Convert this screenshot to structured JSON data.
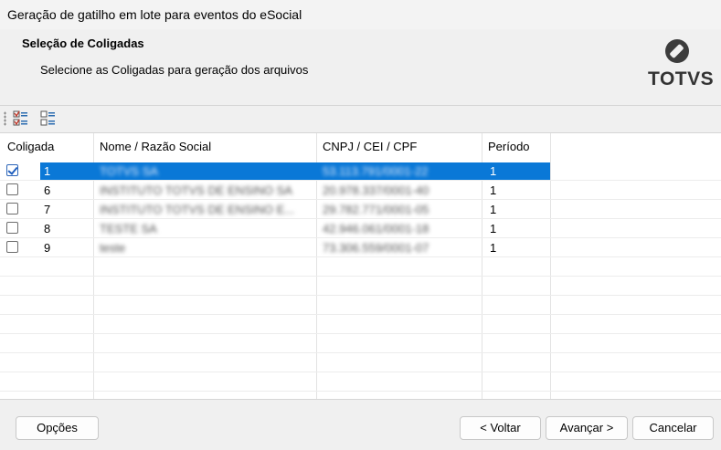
{
  "window": {
    "title": "Geração de gatilho em lote para eventos do eSocial"
  },
  "header": {
    "title": "Seleção de Coligadas",
    "subtitle": "Selecione as Coligadas para geração dos arquivos",
    "logo_text": "TOTVS"
  },
  "toolbar": {
    "buttons": [
      {
        "name": "select-all-icon"
      },
      {
        "name": "deselect-all-icon"
      }
    ]
  },
  "grid": {
    "columns": [
      "Coligada",
      "Nome / Razão Social",
      "CNPJ / CEI / CPF",
      "Período"
    ],
    "rows": [
      {
        "checked": true,
        "coligada": "1",
        "nome": "TOTVS SA",
        "cnpj": "53.113.791/0001-22",
        "periodo": "1",
        "selected": true
      },
      {
        "checked": false,
        "coligada": "6",
        "nome": "INSTITUTO TOTVS DE ENSINO SA",
        "cnpj": "20.978.337/0001-40",
        "periodo": "1",
        "selected": false
      },
      {
        "checked": false,
        "coligada": "7",
        "nome": "INSTITUTO TOTVS DE ENSINO E...",
        "cnpj": "29.782.771/0001-05",
        "periodo": "1",
        "selected": false
      },
      {
        "checked": false,
        "coligada": "8",
        "nome": "TESTE SA",
        "cnpj": "42.946.061/0001-18",
        "periodo": "1",
        "selected": false
      },
      {
        "checked": false,
        "coligada": "9",
        "nome": "teste",
        "cnpj": "73.306.559/0001-07",
        "periodo": "1",
        "selected": false
      }
    ]
  },
  "footer": {
    "options_label": "Opções",
    "back_label": "< Voltar",
    "next_label": "Avançar >",
    "cancel_label": "Cancelar"
  }
}
